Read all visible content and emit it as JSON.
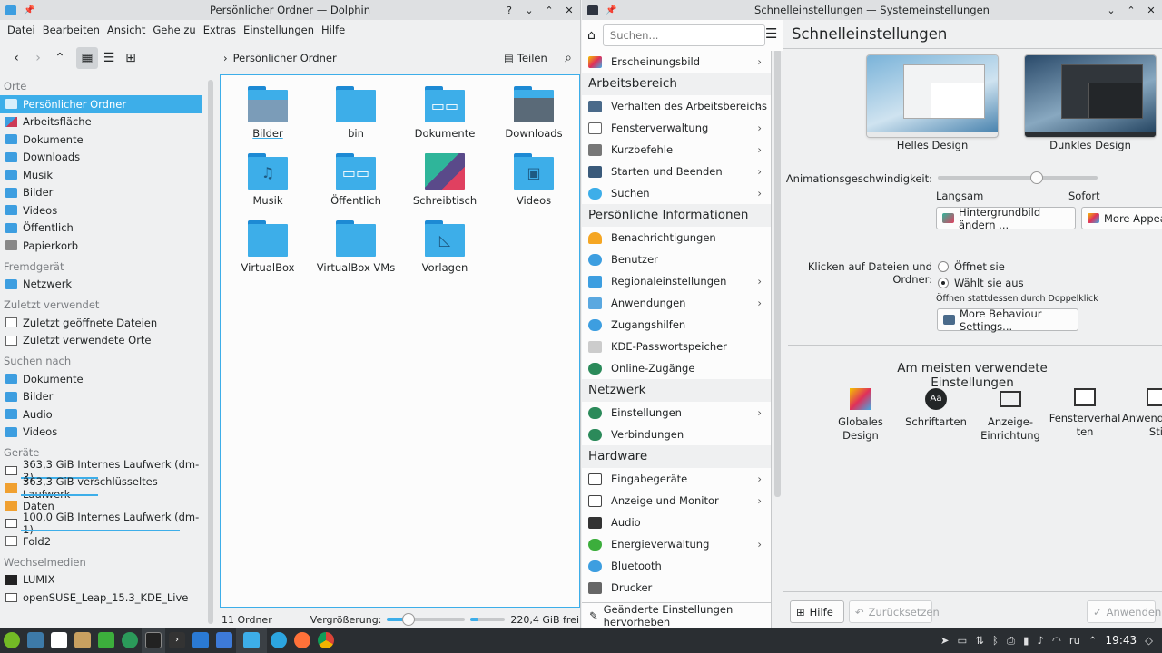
{
  "dolphin": {
    "title": "Persönlicher Ordner — Dolphin",
    "controls": {
      "help": "?",
      "min": "⌄",
      "max": "⌃",
      "close": "✕"
    },
    "menu": [
      "Datei",
      "Bearbeiten",
      "Ansicht",
      "Gehe zu",
      "Extras",
      "Einstellungen",
      "Hilfe"
    ],
    "breadcrumb": "Persönlicher Ordner",
    "share_label": "Teilen",
    "places": {
      "orte_header": "Orte",
      "orte": [
        "Persönlicher Ordner",
        "Arbeitsfläche",
        "Dokumente",
        "Downloads",
        "Musik",
        "Bilder",
        "Videos",
        "Öffentlich",
        "Papierkorb"
      ],
      "remote_header": "Fremdgerät",
      "remote": [
        "Netzwerk"
      ],
      "recent_header": "Zuletzt verwendet",
      "recent": [
        "Zuletzt geöffnete Dateien",
        "Zuletzt verwendete Orte"
      ],
      "search_header": "Suchen nach",
      "search": [
        "Dokumente",
        "Bilder",
        "Audio",
        "Videos"
      ],
      "devices_header": "Geräte",
      "devices": [
        "363,3 GiB Internes Laufwerk (dm-3)",
        "363,3 GiB verschlüsseltes Laufwerk",
        "Daten",
        "100,0 GiB Internes Laufwerk (dm-1)",
        "Fold2"
      ],
      "removable_header": "Wechselmedien",
      "removable": [
        "LUMIX",
        "openSUSE_Leap_15.3_KDE_Live"
      ]
    },
    "files": [
      "Bilder",
      "bin",
      "Dokumente",
      "Downloads",
      "Musik",
      "Öffentlich",
      "Schreibtisch",
      "Videos",
      "VirtualBox",
      "VirtualBox VMs",
      "Vorlagen"
    ],
    "status": {
      "count": "11 Ordner",
      "zoom_label": "Vergrößerung:",
      "zoom_fraction": 0.28,
      "disk_used_fraction": 0.22,
      "free": "220,4 GiB frei"
    }
  },
  "settings": {
    "title": "Schnelleinstellungen — Systemeinstellungen",
    "controls": {
      "min": "⌄",
      "max": "⌃",
      "close": "✕"
    },
    "search_placeholder": "Suchen...",
    "sidebar": {
      "top": "Erscheinungsbild",
      "ws_header": "Arbeitsbereich",
      "ws": [
        "Verhalten des Arbeitsbereichs",
        "Fensterverwaltung",
        "Kurzbefehle",
        "Starten und Beenden",
        "Suchen"
      ],
      "pi_header": "Persönliche Informationen",
      "pi": [
        "Benachrichtigungen",
        "Benutzer",
        "Regionaleinstellungen",
        "Anwendungen",
        "Zugangshilfen",
        "KDE-Passwortspeicher",
        "Online-Zugänge"
      ],
      "net_header": "Netzwerk",
      "net": [
        "Einstellungen",
        "Verbindungen"
      ],
      "hw_header": "Hardware",
      "hw": [
        "Eingabegeräte",
        "Anzeige und Monitor",
        "Audio",
        "Energieverwaltung",
        "Bluetooth",
        "Drucker"
      ],
      "footer": "Geänderte Einstellungen hervorheben"
    },
    "page_title": "Schnelleinstellungen",
    "light_theme": "Helles Design",
    "dark_theme": "Dunkles Design",
    "anim_label": "Animationsgeschwindigkeit:",
    "anim_fraction": 0.62,
    "slow": "Langsam",
    "instant": "Sofort",
    "wallpaper_btn": "Hintergrundbild ändern ...",
    "more_appearance_btn": "More Appearance Settings...",
    "click_label": "Klicken auf Dateien und Ordner:",
    "open_opt": "Öffnet sie",
    "select_opt": "Wählt sie aus",
    "hint": "Öffnen stattdessen durch Doppelklick",
    "more_behaviour_btn": "More Behaviour Settings...",
    "most_used_title": "Am meisten verwendete Einstellungen",
    "most_used": [
      "Globales Design",
      "Schriftarten",
      "Anzeige-Einrichtung",
      "Fensterverhalten",
      "Anwendungs-Stil"
    ],
    "help_btn": "Hilfe",
    "reset_btn": "Zurücksetzen",
    "apply_btn": "Anwenden"
  },
  "taskbar": {
    "lang": "ru",
    "time": "19:43"
  }
}
